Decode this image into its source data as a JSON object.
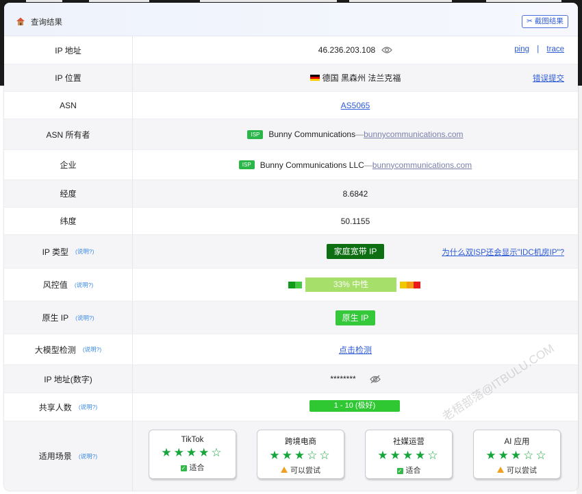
{
  "header": {
    "title": "查询结果",
    "screenshot_label": "✂ 截图结果"
  },
  "rows": {
    "ip": {
      "label": "IP 地址",
      "value": "46.236.203.108",
      "ping": "ping",
      "sep": "|",
      "trace": "trace"
    },
    "location": {
      "label": "IP 位置",
      "value": "德国 黑森州 法兰克福",
      "report": "错误提交"
    },
    "asn": {
      "label": "ASN",
      "value": "AS5065"
    },
    "asn_owner": {
      "label": "ASN 所有者",
      "tag": "ISP",
      "name": "Bunny Communications",
      "dash": "— ",
      "domain": "bunnycommunications.com"
    },
    "company": {
      "label": "企业",
      "tag": "ISP",
      "name": "Bunny Communications LLC",
      "dash": "— ",
      "domain": "bunnycommunications.com"
    },
    "longitude": {
      "label": "经度",
      "value": "8.6842"
    },
    "latitude": {
      "label": "纬度",
      "value": "50.1155"
    },
    "ip_type": {
      "label": "IP 类型",
      "help": "(说明?)",
      "value": "家庭宽带 IP",
      "link": "为什么双ISP还会显示\"IDC机房IP\"?"
    },
    "risk": {
      "label": "风控值",
      "help": "(说明?)",
      "value": "33%  中性",
      "score": 0.33
    },
    "native": {
      "label": "原生 IP",
      "help": "(说明?)",
      "value": "原生 IP"
    },
    "llm": {
      "label": "大模型检测",
      "help": "(说明?)",
      "value": "点击检测"
    },
    "ip_numeric": {
      "label": "IP 地址(数字)",
      "value": "********"
    },
    "shared": {
      "label": "共享人数",
      "help": "(说明?)",
      "value": "1 - 10 (极好)"
    },
    "scenes": {
      "label": "适用场景",
      "help": "(说明?)",
      "items": [
        {
          "name": "TikTok",
          "stars": "★★★★☆",
          "rating": 4,
          "status": "适合",
          "status_type": "ok"
        },
        {
          "name": "跨境电商",
          "stars": "★★★☆☆",
          "rating": 3,
          "status": "可以尝试",
          "status_type": "warn"
        },
        {
          "name": "社媒运营",
          "stars": "★★★★☆",
          "rating": 4,
          "status": "适合",
          "status_type": "ok"
        },
        {
          "name": "AI 应用",
          "stars": "★★★☆☆",
          "rating": 3,
          "status": "可以尝试",
          "status_type": "warn"
        }
      ]
    }
  },
  "watermark": "老梧部落@ITBULU.COM",
  "colors": {
    "accent": "#2d5bd6",
    "green": "#35c83a",
    "dark_green": "#0d6e12",
    "risk_bar": "#a6df6a"
  }
}
